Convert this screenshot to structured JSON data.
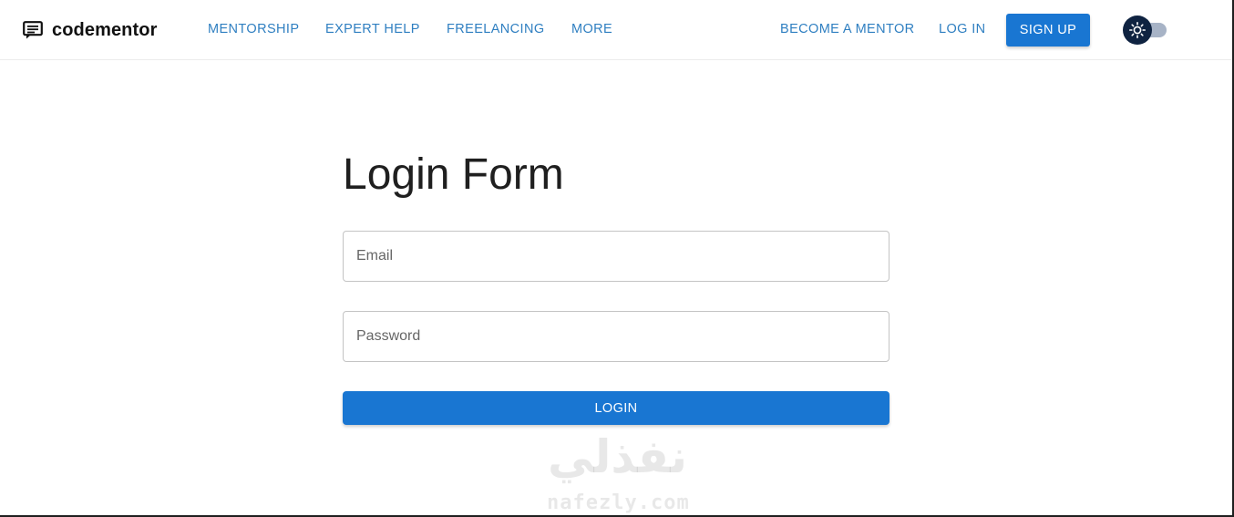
{
  "brand": {
    "name": "codementor",
    "icon": "chat-screen-icon"
  },
  "nav": {
    "items": [
      {
        "label": "MENTORSHIP"
      },
      {
        "label": "EXPERT HELP"
      },
      {
        "label": "FREELANCING"
      },
      {
        "label": "MORE"
      }
    ],
    "become_mentor": "BECOME A MENTOR",
    "login": "LOG IN",
    "signup": "SIGN UP"
  },
  "theme_toggle": {
    "icon": "sun-icon",
    "mode": "light"
  },
  "form": {
    "title": "Login Form",
    "email_placeholder": "Email",
    "password_placeholder": "Password",
    "submit_label": "LOGIN"
  },
  "watermark": {
    "arabic": "نفذلي",
    "latin": "nafezly.com"
  },
  "colors": {
    "accent": "#1976d2",
    "link": "#2f7fc1",
    "toggle_thumb": "#0f2341",
    "toggle_track": "#a7b3c6"
  }
}
